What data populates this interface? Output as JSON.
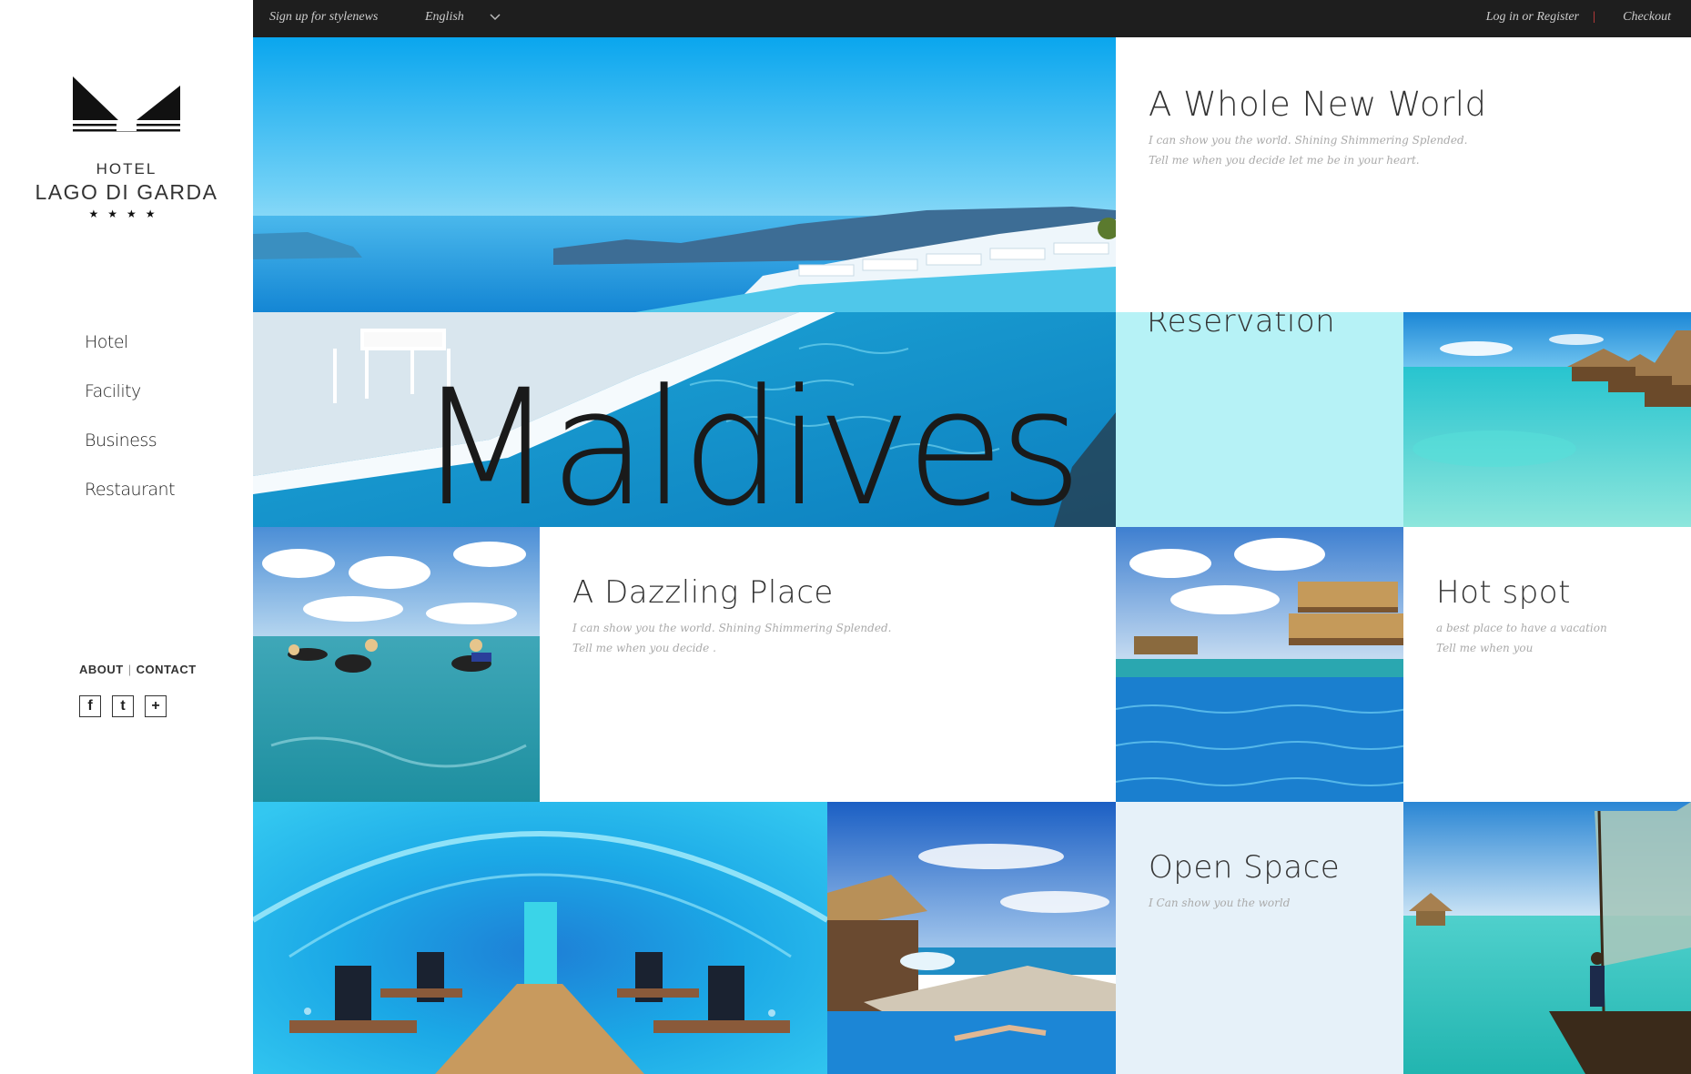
{
  "topbar": {
    "signup": "Sign up for stylenews",
    "language": "English",
    "login": "Log in or Register",
    "separator": "|",
    "checkout": "Checkout"
  },
  "logo": {
    "line1": "HOTEL",
    "line2": "LAGO DI GARDA",
    "stars": "★★★★"
  },
  "nav": [
    "Hotel",
    "Facility",
    "Business",
    "Restaurant"
  ],
  "footer": {
    "about": "ABOUT",
    "separator": "|",
    "contact": "CONTACT",
    "social": [
      "f",
      "t",
      "+"
    ]
  },
  "tiles": {
    "whole_new_world": {
      "title": "A Whole New World",
      "line1": "I can show you the world. Shining Shimmering Splended.",
      "line2": "Tell me when you decide let me be in your heart."
    },
    "reservation": {
      "title": "Reservation"
    },
    "maldives": {
      "title": "Maldives"
    },
    "dazzling": {
      "title": "A Dazzling Place",
      "line1": "I can show you the world. Shining Shimmering Splended.",
      "line2": "Tell me when you decide ."
    },
    "hotspot": {
      "title": "Hot spot",
      "line1": "a best place to have a vacation",
      "line2": "Tell me when you"
    },
    "open_space": {
      "title": "Open Space",
      "line1": "I Can show you the world"
    }
  },
  "colors": {
    "topbar_bg": "#1e1e1e",
    "reservation_bg": "#b6f2f6",
    "open_space_bg": "#e6f1f9",
    "accent_pipe": "#ee4444"
  }
}
